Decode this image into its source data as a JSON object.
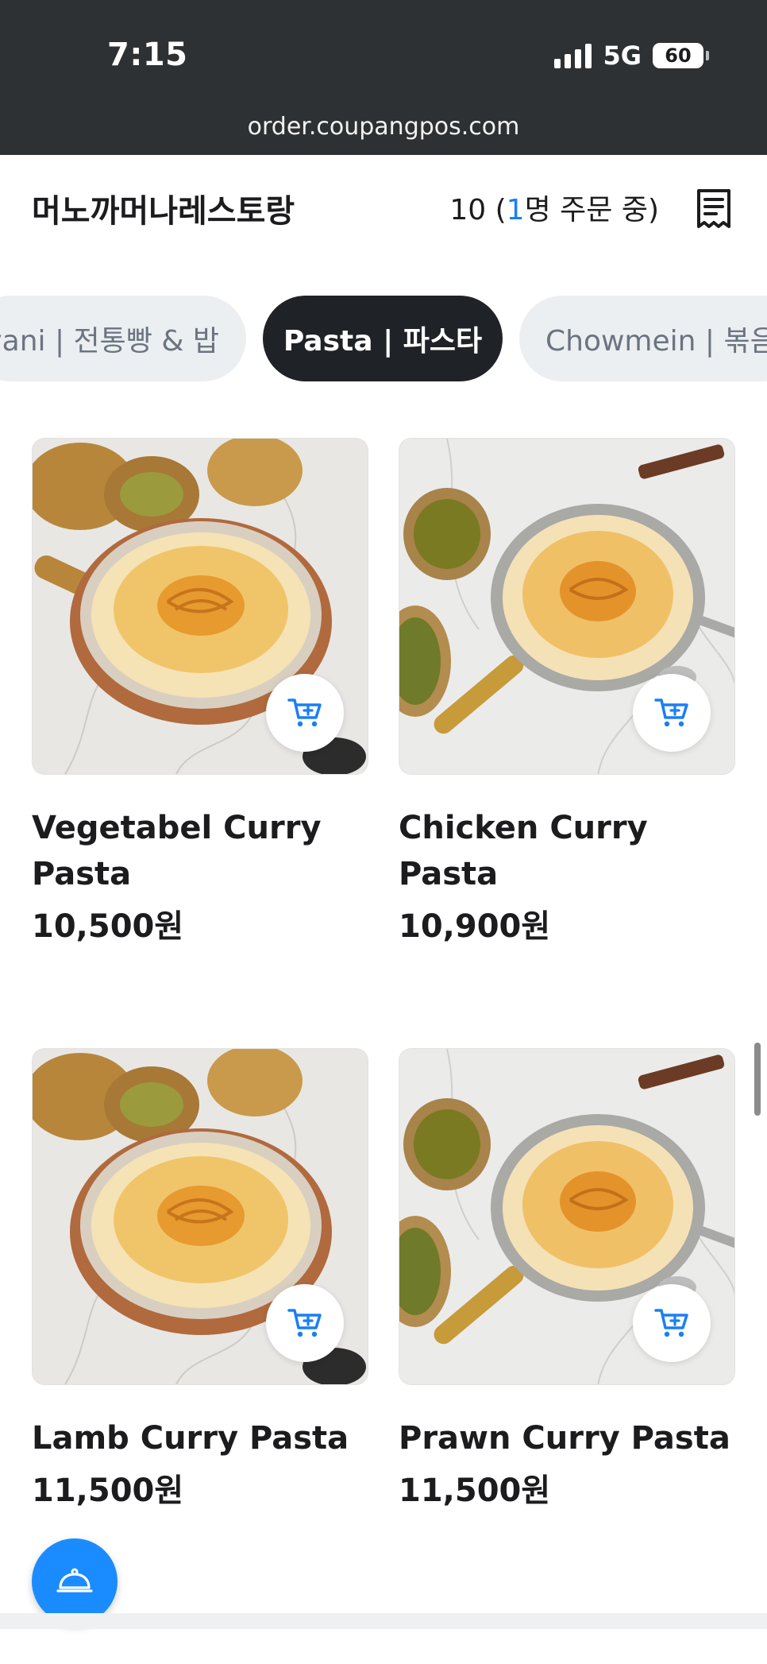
{
  "status_bar": {
    "time": "7:15",
    "network": "5G",
    "battery": "60"
  },
  "browser": {
    "url": "order.coupangpos.com"
  },
  "header": {
    "restaurant_name": "머노까머나레스토랑",
    "table_number": "10 (",
    "ordering_count": "1",
    "ordering_suffix": "명 주문 중)"
  },
  "categories": [
    {
      "label": "yani | 전통빵 & 밥",
      "active": false
    },
    {
      "label": "Pasta | 파스타",
      "active": true
    },
    {
      "label": "Chowmein | 볶음",
      "active": false
    }
  ],
  "menu_items": [
    {
      "name": "Vegetabel Curry Pasta",
      "price": "10,500원",
      "icon": "add-to-cart-icon"
    },
    {
      "name": "Chicken Curry Pasta",
      "price": "10,900원",
      "icon": "add-to-cart-icon"
    },
    {
      "name": "Lamb Curry Pasta",
      "price": "11,500원",
      "icon": "add-to-cart-icon"
    },
    {
      "name": "Prawn Curry Pasta",
      "price": "11,500원",
      "icon": "add-to-cart-icon"
    }
  ],
  "fab": {
    "icon": "service-bell-icon"
  },
  "colors": {
    "accent": "#1a8cff",
    "active_tab": "#1f2327",
    "status_bar": "#2e3133"
  }
}
